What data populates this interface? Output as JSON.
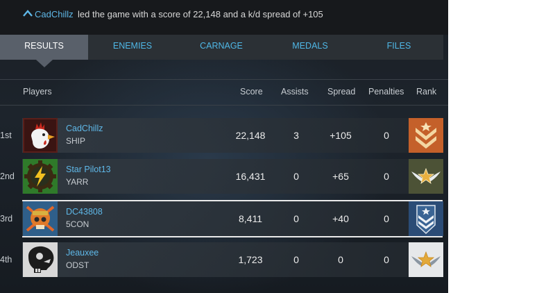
{
  "banner": {
    "leader_name": "CadChillz",
    "message": "led the game with a score of 22,148 and a k/d spread of +105"
  },
  "tabs": [
    {
      "label": "RESULTS",
      "active": true
    },
    {
      "label": "ENEMIES",
      "active": false
    },
    {
      "label": "CARNAGE",
      "active": false
    },
    {
      "label": "MEDALS",
      "active": false
    },
    {
      "label": "FILES",
      "active": false
    }
  ],
  "columns": {
    "players": "Players",
    "score": "Score",
    "assists": "Assists",
    "spread": "Spread",
    "penalties": "Penalties",
    "rank": "Rank"
  },
  "rows": [
    {
      "place": "1st",
      "name": "CadChillz",
      "clan": "SHIP",
      "score": "22,148",
      "assists": "3",
      "spread": "+105",
      "penalties": "0",
      "emblem": "rooster-emblem",
      "rank": "sergeant-chevron-rank"
    },
    {
      "place": "2nd",
      "name": "Star Pilot13",
      "clan": "YARR",
      "score": "16,431",
      "assists": "0",
      "spread": "+65",
      "penalties": "0",
      "emblem": "lightning-gear-emblem",
      "rank": "winged-star-rank"
    },
    {
      "place": "3rd",
      "name": "DC43808",
      "clan": "5CON",
      "score": "8,411",
      "assists": "0",
      "spread": "+40",
      "penalties": "0",
      "emblem": "skull-emblem",
      "rank": "chevron-shield-rank"
    },
    {
      "place": "4th",
      "name": "Jeauxee",
      "clan": "ODST",
      "score": "1,723",
      "assists": "0",
      "spread": "0",
      "penalties": "0",
      "emblem": "alien-skull-emblem",
      "rank": "silver-winged-star-rank"
    }
  ],
  "colors": {
    "accent": "#5fb8e8",
    "tab_active": "#59606a",
    "bar": "#2b3035"
  }
}
